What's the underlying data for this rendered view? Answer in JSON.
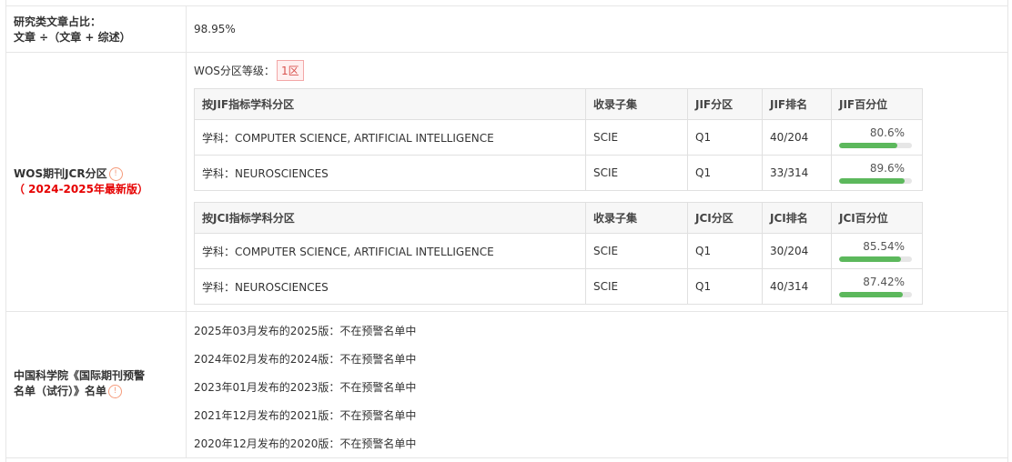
{
  "research_ratio": {
    "label_line1": "研究类文章占比：",
    "label_line2": "文章 ÷（文章 + 综述）",
    "value": "98.95%"
  },
  "wos": {
    "label": "WOS期刊JCR分区",
    "label_year": "（ 2024-2025年最新版）",
    "level_label": "WOS分区等级：",
    "level_value": "1区",
    "jif_table": {
      "headers": [
        "按JIF指标学科分区",
        "收录子集",
        "JIF分区",
        "JIF排名",
        "JIF百分位"
      ],
      "rows": [
        {
          "subject": "学科：COMPUTER SCIENCE, ARTIFICIAL INTELLIGENCE",
          "subset": "SCIE",
          "quartile": "Q1",
          "rank": "40/204",
          "percentile": "80.6%",
          "pct_value": 80.6
        },
        {
          "subject": "学科：NEUROSCIENCES",
          "subset": "SCIE",
          "quartile": "Q1",
          "rank": "33/314",
          "percentile": "89.6%",
          "pct_value": 89.6
        }
      ]
    },
    "jci_table": {
      "headers": [
        "按JCI指标学科分区",
        "收录子集",
        "JCI分区",
        "JCI排名",
        "JCI百分位"
      ],
      "rows": [
        {
          "subject": "学科：COMPUTER SCIENCE, ARTIFICIAL INTELLIGENCE",
          "subset": "SCIE",
          "quartile": "Q1",
          "rank": "30/204",
          "percentile": "85.54%",
          "pct_value": 85.54
        },
        {
          "subject": "学科：NEUROSCIENCES",
          "subset": "SCIE",
          "quartile": "Q1",
          "rank": "40/314",
          "percentile": "87.42%",
          "pct_value": 87.42
        }
      ]
    }
  },
  "warning": {
    "label_line1": "中国科学院《国际期刊预警",
    "label_line2": "名单（试行）》名单",
    "entries": [
      "2025年03月发布的2025版：不在预警名单中",
      "2024年02月发布的2024版：不在预警名单中",
      "2023年01月发布的2023版：不在预警名单中",
      "2021年12月发布的2021版：不在预警名单中",
      "2020年12月发布的2020版：不在预警名单中"
    ]
  },
  "colors": {
    "bar_fill": "#5cb85c",
    "bar_track": "#e6e6e6",
    "accent_red": "#e60000",
    "info_icon": "#f59b7b"
  }
}
